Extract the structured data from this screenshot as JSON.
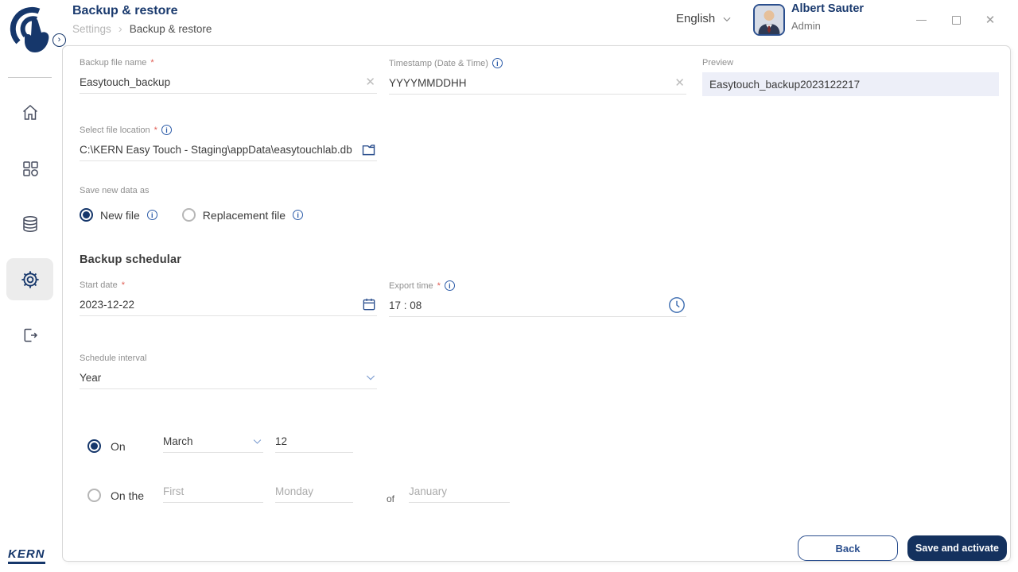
{
  "icons": {
    "breadcrumb_separator": "›",
    "clear": "✕",
    "info": "i",
    "close": "✕",
    "collapse_chevron": "›"
  },
  "colors": {
    "primary_navy": "#16376b",
    "accent_blue": "#2b5ba8",
    "preview_bg": "#edeff8",
    "required_red": "#e05b52"
  },
  "header": {
    "title": "Backup & restore",
    "breadcrumb": {
      "parent": "Settings",
      "current": "Backup & restore"
    },
    "language": "English",
    "user": {
      "name": "Albert Sauter",
      "role": "Admin"
    }
  },
  "sidebar": {
    "brand": "KERN"
  },
  "form": {
    "required_mark": "*",
    "backup_file_name": {
      "label": "Backup file name",
      "value": "Easytouch_backup"
    },
    "timestamp": {
      "label": "Timestamp (Date & Time)",
      "value": "YYYYMMDDHH"
    },
    "preview": {
      "label": "Preview",
      "value": "Easytouch_backup2023122217"
    },
    "file_location": {
      "label": "Select file location",
      "value": "C:\\KERN Easy Touch - Staging\\appData\\easytouchlab.db"
    },
    "save_as": {
      "label": "Save new data as",
      "option_new": "New file",
      "option_replacement": "Replacement file"
    },
    "scheduler": {
      "heading": "Backup schedular",
      "start_date": {
        "label": "Start date",
        "value": "2023-12-22"
      },
      "export_time": {
        "label": "Export time",
        "value": "17 : 08"
      },
      "interval": {
        "label": "Schedule interval",
        "value": "Year"
      },
      "on_row": {
        "label": "On",
        "month": "March",
        "day": "12"
      },
      "on_the_row": {
        "label": "On the",
        "ordinal_placeholder": "First",
        "weekday_placeholder": "Monday",
        "of_label": "of",
        "month_placeholder": "January"
      }
    }
  },
  "footer": {
    "back": "Back",
    "save": "Save and activate"
  }
}
